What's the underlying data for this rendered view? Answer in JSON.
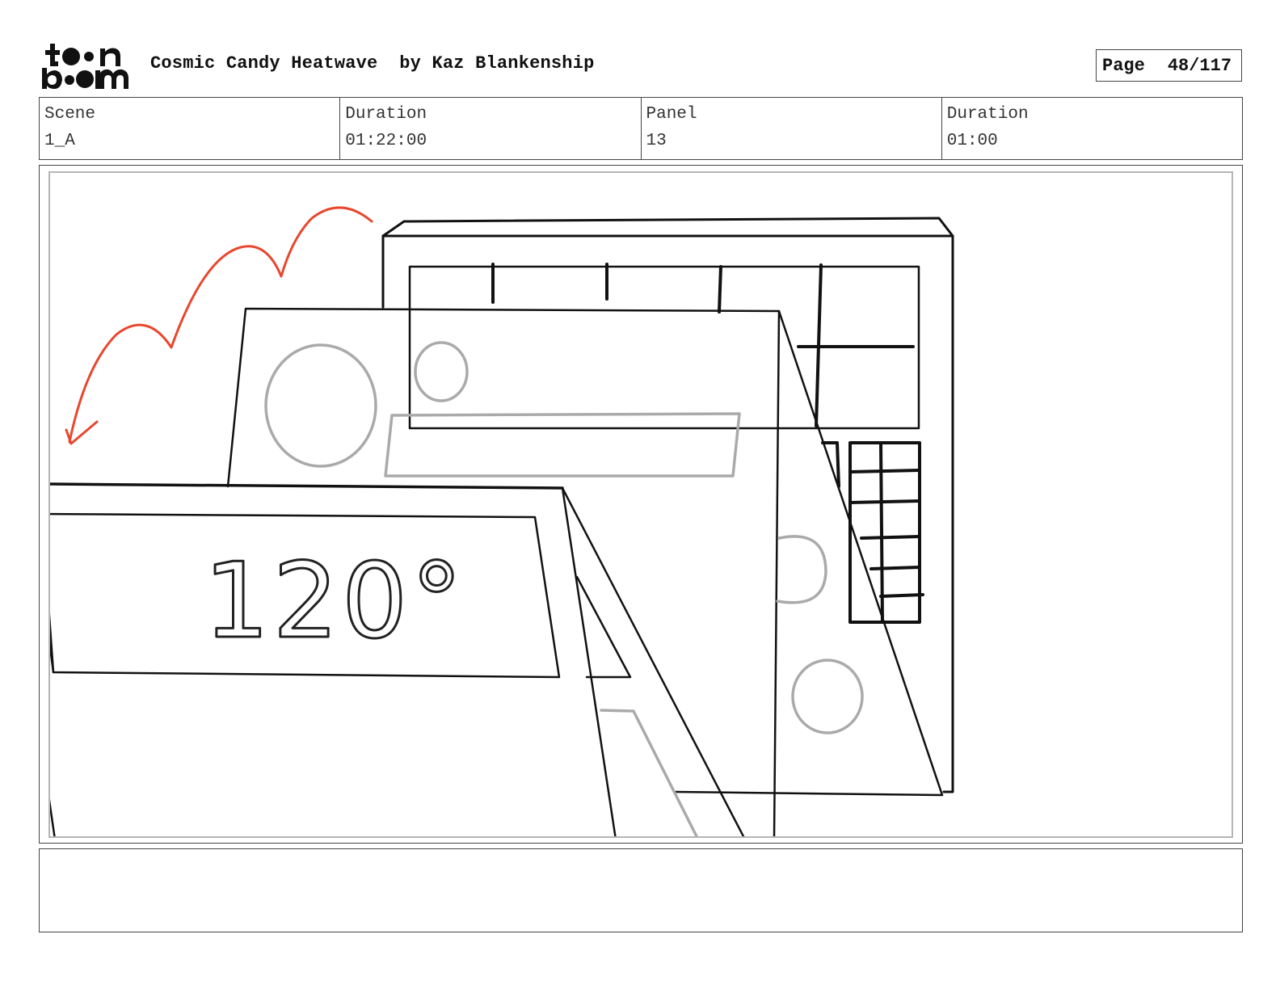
{
  "header": {
    "logo_text": "toonboom",
    "title": "Cosmic Candy Heatwave",
    "author": "by Kaz Blankenship",
    "page_label": "Page",
    "page_number": "48/117"
  },
  "info": {
    "scene_label": "Scene",
    "scene_value": "1_A",
    "scene_duration_label": "Duration",
    "scene_duration_value": "01:22:00",
    "panel_label": "Panel",
    "panel_value": "13",
    "panel_duration_label": "Duration",
    "panel_duration_value": "01:00"
  },
  "sketch": {
    "sign_text": "120°",
    "arrow_color": "#e8472e",
    "line_color": "#111111",
    "secondary_color": "#aaaaaa"
  },
  "caption": {
    "text": ""
  }
}
